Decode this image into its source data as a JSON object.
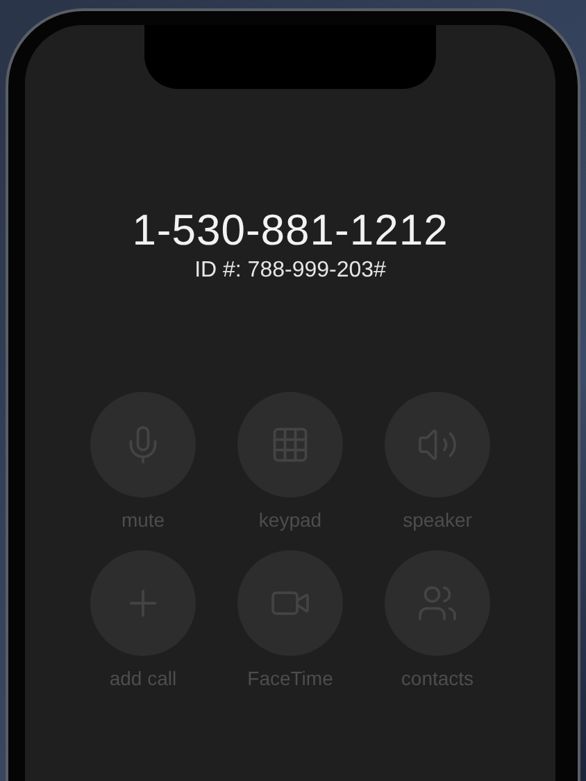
{
  "call": {
    "number": "1-530-881-1212",
    "caller_id": "ID #: 788-999-203#"
  },
  "buttons": [
    {
      "kind": "mute",
      "label": "mute"
    },
    {
      "kind": "keypad",
      "label": "keypad"
    },
    {
      "kind": "speaker",
      "label": "speaker"
    },
    {
      "kind": "add",
      "label": "add call"
    },
    {
      "kind": "video",
      "label": "FaceTime"
    },
    {
      "kind": "contacts",
      "label": "contacts"
    }
  ]
}
